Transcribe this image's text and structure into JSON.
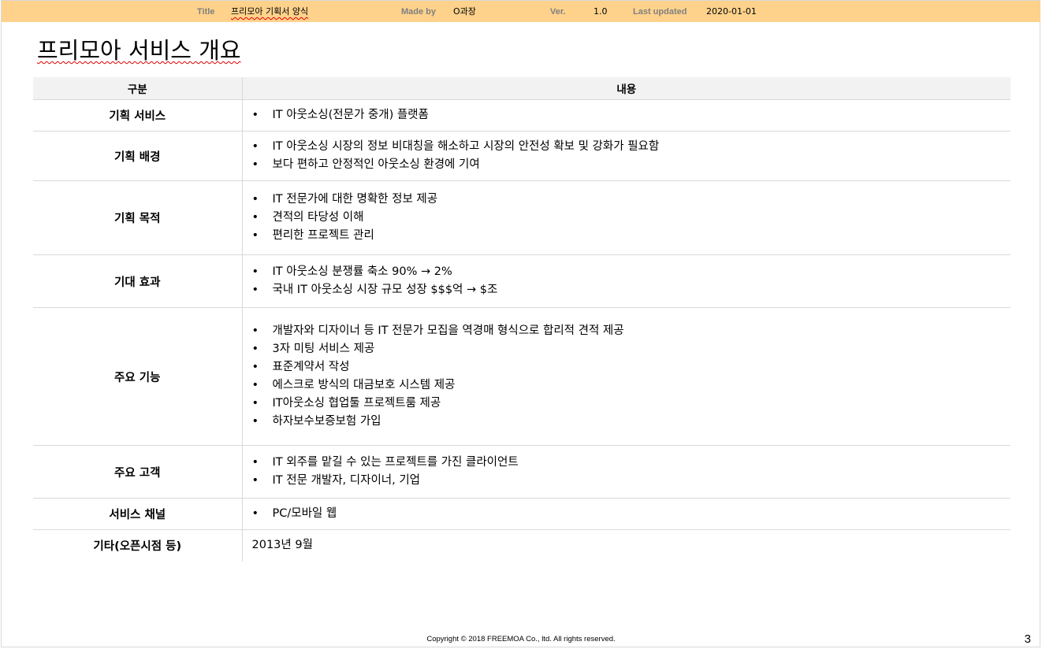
{
  "header": {
    "title_label": "Title",
    "title_value": "프리모아 기획서 양식",
    "made_by_label": "Made by",
    "made_by_value": "O과장",
    "version_label": "Ver.",
    "version_value": "1.0",
    "updated_label": "Last updated",
    "updated_value": "2020-01-01"
  },
  "page_title": "프리모아 서비스 개요",
  "table": {
    "headers": [
      "구분",
      "내용"
    ],
    "rows": [
      {
        "category": "기획 서비스",
        "items": [
          "IT 아웃소싱(전문가 중개) 플랫폼"
        ]
      },
      {
        "category": "기획 배경",
        "items": [
          "IT 아웃소싱 시장의 정보 비대칭을 해소하고 시장의 안전성 확보 및 강화가 필요함",
          "보다 편하고 안정적인 아웃소싱 환경에 기여"
        ]
      },
      {
        "category": "기획 목적",
        "items": [
          "IT 전문가에 대한 명확한 정보 제공",
          "견적의 타당성 이해",
          "편리한 프로젝트 관리"
        ]
      },
      {
        "category": "기대 효과",
        "items": [
          "IT 아웃소싱 분쟁률  축소 90% → 2%",
          "국내 IT 아웃소싱 시장 규모 성장 $$$억 → $조"
        ]
      },
      {
        "category": "주요 기능",
        "items": [
          "개발자와 디자이너 등 IT 전문가 모집을 역경매 형식으로 합리적 견적 제공",
          "3자 미팅 서비스 제공",
          "표준계약서 작성",
          "에스크로 방식의  대금보호 시스템 제공",
          "IT아웃소싱 협업툴 프로젝트룸 제공",
          "하자보수보증보험 가입"
        ]
      },
      {
        "category": "주요 고객",
        "items": [
          "IT 외주를 맡길 수 있는 프로젝트를 가진 클라이언트",
          "IT 전문 개발자, 디자이너, 기업"
        ]
      },
      {
        "category": "서비스 채널",
        "items": [
          "PC/모바일 웹"
        ]
      },
      {
        "category": "기타(오픈시점 등)",
        "text": "2013년 9월"
      }
    ]
  },
  "footer": {
    "copyright": "Copyright © 2018 FREEMOA Co., ltd. All rights reserved.",
    "page_number": "3"
  },
  "colors": {
    "header_bar": "#ffd28c",
    "header_label": "#7f7f7f",
    "table_header_bg": "#f2f2f2",
    "grid_line": "#d9d9d9"
  }
}
